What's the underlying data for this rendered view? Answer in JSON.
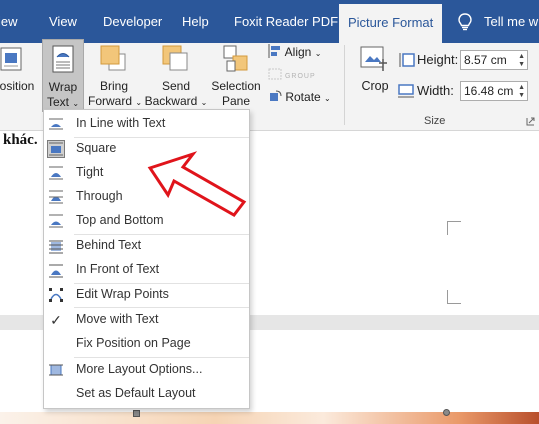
{
  "tabs": {
    "view": "View",
    "developer": "Developer",
    "help": "Help",
    "foxit": "Foxit Reader PDF",
    "picture_format": "Picture Format",
    "tell_me": "Tell me wh"
  },
  "ribbon": {
    "position_label": "Position",
    "wrap_text_line1": "Wrap",
    "wrap_text_line2": "Text",
    "bring_forward_line1": "Bring",
    "bring_forward_line2": "Forward",
    "send_backward_line1": "Send",
    "send_backward_line2": "Backward",
    "selection_pane_line1": "Selection",
    "selection_pane_line2": "Pane",
    "align": "Align",
    "group": "Group",
    "rotate": "Rotate",
    "crop": "Crop",
    "height_label": "Height:",
    "height_value": "8.57 cm",
    "width_label": "Width:",
    "width_value": "16.48 cm",
    "size_group_label": "Size"
  },
  "document": {
    "text_fragment": "khác."
  },
  "wrap_menu": {
    "items": [
      {
        "label": "In Line with Text",
        "icon": "inline-wrap-icon"
      },
      {
        "label": "Square",
        "icon": "square-wrap-icon",
        "selected": true
      },
      {
        "label": "Tight",
        "icon": "tight-wrap-icon"
      },
      {
        "label": "Through",
        "icon": "through-wrap-icon"
      },
      {
        "label": "Top and Bottom",
        "icon": "top-bottom-wrap-icon"
      },
      {
        "label": "Behind Text",
        "icon": "behind-text-icon"
      },
      {
        "label": "In Front of Text",
        "icon": "in-front-text-icon"
      },
      {
        "label": "Edit Wrap Points",
        "icon": "edit-wrap-points-icon"
      },
      {
        "label": "Move with Text",
        "icon": "checkmark-icon",
        "checked": true
      },
      {
        "label": "Fix Position on Page",
        "icon": ""
      },
      {
        "label": "More Layout Options...",
        "icon": "layout-options-icon"
      },
      {
        "label": "Set as Default Layout",
        "icon": ""
      }
    ]
  },
  "colors": {
    "ribbon_blue": "#2b579a",
    "ribbon_body": "#f3f3f3",
    "annotation_arrow": "#e0141b"
  }
}
